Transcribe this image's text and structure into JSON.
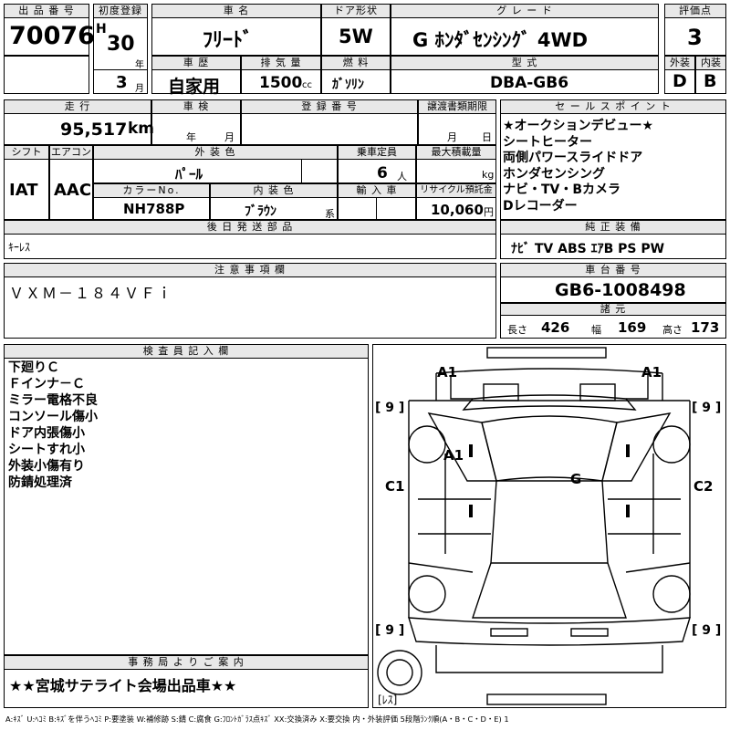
{
  "header": {
    "lot_no_label": "出 品 番 号",
    "lot_no": "70076",
    "first_reg_label": "初度登録",
    "era": "H",
    "year": "30",
    "year_unit": "年",
    "month": "3",
    "month_unit": "月",
    "car_name_label": "車 名",
    "car_name": "ﾌﾘｰﾄﾞ",
    "door_label": "ドア形状",
    "door": "5W",
    "grade_label": "グ レ ー ド",
    "grade": "G ﾎﾝﾀﾞｾﾝｼﾝｸﾞ 4WD",
    "score_label": "評価点",
    "score": "3",
    "history_label": "車 歴",
    "history": "自家用",
    "displacement_label": "排 気 量",
    "displacement": "1500",
    "cc_unit": "cc",
    "fuel_label": "燃 料",
    "fuel": "ｶﾞｿﾘﾝ",
    "model_label": "型 式",
    "model": "DBA-GB6",
    "ext_label": "外装",
    "ext_grade": "D",
    "int_label": "内装",
    "int_grade": "B"
  },
  "row2": {
    "mileage_label": "走 行",
    "mileage": "95,517",
    "mileage_unit": "km",
    "inspection_label": "車 検",
    "insp_year_unit": "年",
    "insp_month_unit": "月",
    "reg_no_label": "登 録 番 号",
    "transfer_label": "譲渡書類期限",
    "tr_month_unit": "月",
    "tr_day_unit": "日",
    "shift_label": "シフト",
    "shift": "IAT",
    "ac_label": "エアコン",
    "ac": "AAC",
    "color_label": "外 装 色",
    "color": "ﾊﾟｰﾙ",
    "capacity_label": "乗車定員",
    "capacity": "6",
    "capacity_unit": "人",
    "load_label": "最大積載量",
    "load_unit": "kg",
    "color_no_label": "カラーNo.",
    "color_no": "NH788P",
    "int_color_label": "内 装 色",
    "int_color": "ﾌﾞﾗｳﾝ",
    "int_color_unit": "系",
    "import_label": "輸 入 車",
    "recycle_label": "リサイクル預託金",
    "recycle": "10,060",
    "recycle_unit": "円"
  },
  "sales_points": {
    "label": "セ ー ル ス ポ イ ン ト",
    "items": [
      "★オークションデビュー★",
      "シートヒーター",
      "両側パワースライドドア",
      "ホンダセンシング",
      "ナビ・TV・Bカメラ",
      "Dレコーダー"
    ]
  },
  "later_parts": {
    "label": "後 日 発 送 部 品",
    "value": "ｷｰﾚｽ"
  },
  "equipment": {
    "label": "純 正 装 備",
    "value": "ﾅﾋﾞ TV ABS ｴｱB PS PW"
  },
  "notes": {
    "label": "注 意 事 項 欄",
    "value": "ＶＸＭ－１８４ＶＦｉ"
  },
  "chassis": {
    "label": "車 台 番 号",
    "value": "GB6-1008498"
  },
  "dims": {
    "label": "諸 元",
    "length_label": "長さ",
    "length": "426",
    "width_label": "幅",
    "width": "169",
    "height_label": "高さ",
    "height": "173"
  },
  "inspector": {
    "label": "検 査 員 記 入 欄",
    "items": [
      "下廻りＣ",
      "Ｆインナ－Ｃ",
      "ミラー電格不良",
      "コンソール傷小",
      "ドア内張傷小",
      "シートすれ小",
      "外装小傷有り",
      "防錆処理済"
    ]
  },
  "office": {
    "label": "事 務 局 よ り ご 案 内",
    "value": "★★宮城サテライト会場出品車★★"
  },
  "diagram": {
    "marks": {
      "a1_fl": "A1",
      "a1_fr": "A1",
      "a1_door": "A1",
      "g_glass": "G",
      "c1_left": "C1",
      "c2_right": "C2",
      "tire_fl": "[ 9 ]",
      "tire_fr": "[ 9 ]",
      "tire_rl": "[ 9 ]",
      "tire_rr": "[ 9 ]",
      "spare": "[ﾚｽ]"
    }
  },
  "legend": "A:ｷｽﾞ U:ﾍｺﾐ B:ｷｽﾞを伴うﾍｺﾐ P:要塗装 W:補修跡 S:錆 C:腐食 G:ﾌﾛﾝﾄｶﾞﾗｽ点ｷｽﾞ XX:交換済み X:要交換 内・外装評価 5段階ﾗﾝｸ順(A・B・C・D・E) 1"
}
